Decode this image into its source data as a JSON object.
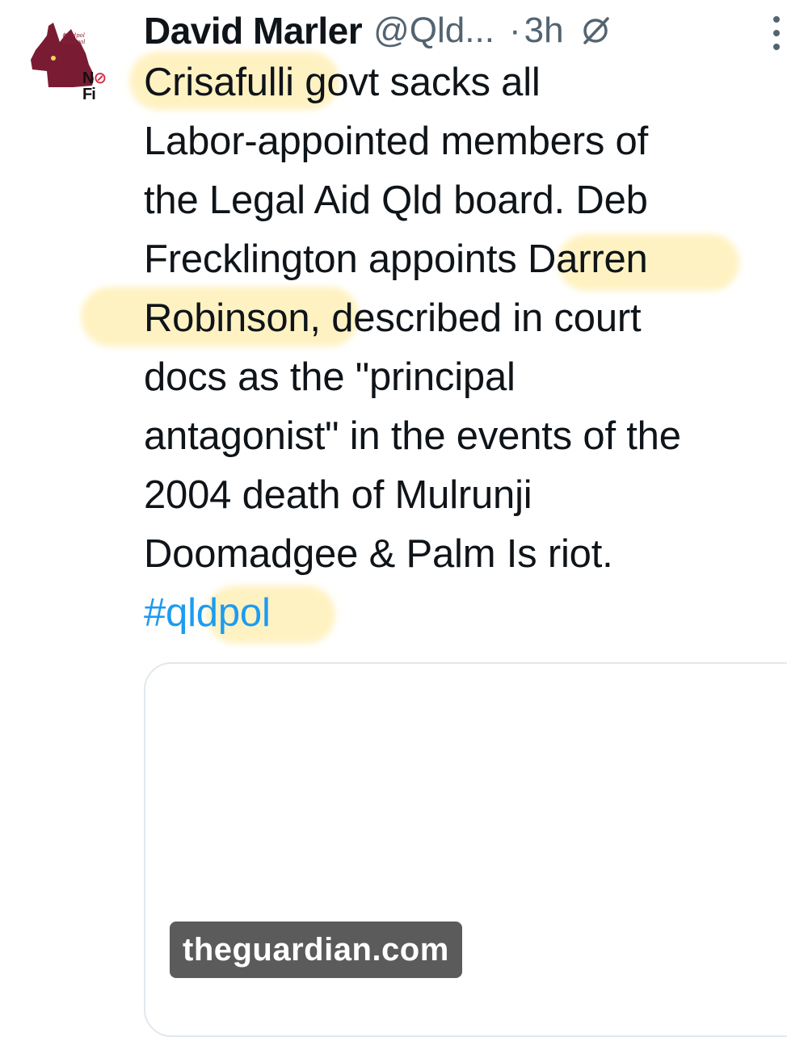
{
  "author": {
    "name": "David Marler",
    "handle": "@Qld...",
    "separator": "·",
    "time": "3h",
    "avatar": {
      "tiny_text": "#qldpol #auspol",
      "logo_top": "N",
      "logo_circle": "⊘",
      "logo_bottom": "Fi"
    }
  },
  "tweet": {
    "lines": [
      "Crisafulli govt sacks all",
      "Labor-appointed members of",
      "the Legal Aid Qld board. Deb",
      "Frecklington appoints Darren",
      "Robinson, described in court",
      "docs as the \"principal",
      "antagonist\" in the events of the",
      "2004 death of Mulrunji",
      "Doomadgee & Palm Is riot."
    ],
    "hashtag": "#qldpol"
  },
  "card": {
    "domain": "theguardian.com"
  },
  "colors": {
    "text": "#0f1419",
    "secondary": "#536471",
    "link": "#1d9bf0",
    "highlight": "#ffe278",
    "avatar_maroon": "#7a1b34"
  },
  "icons": [
    "edited-icon",
    "more-icon",
    "queensland-map-icon"
  ]
}
